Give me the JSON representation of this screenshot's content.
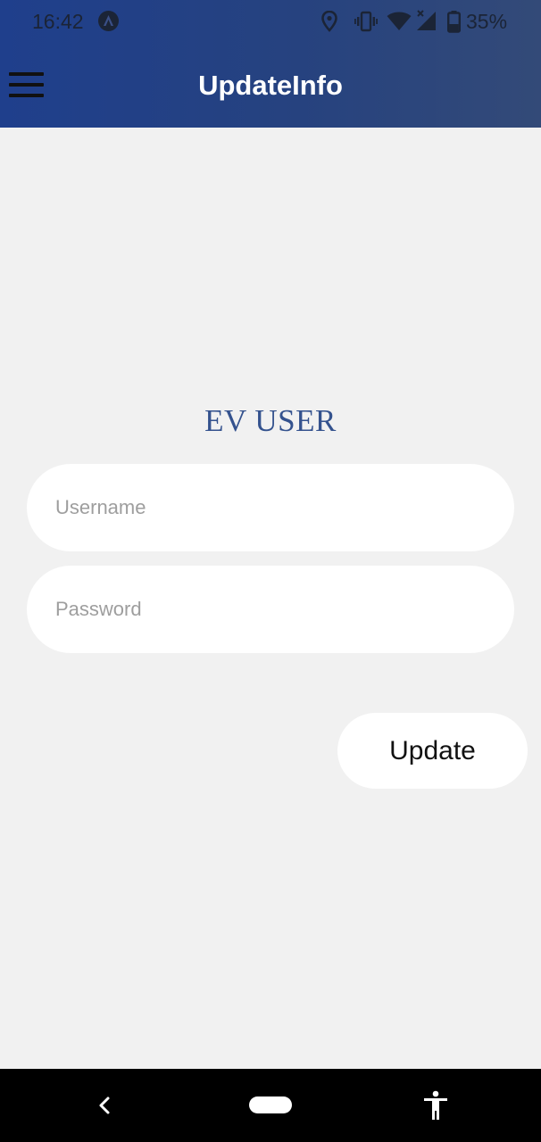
{
  "status_bar": {
    "time": "16:42",
    "battery": "35%",
    "icons": [
      "app-notification-icon",
      "location-icon",
      "vibrate-icon",
      "wifi-icon",
      "signal-icon",
      "battery-icon"
    ]
  },
  "app_bar": {
    "menu_icon": "hamburger-menu-icon",
    "title": "UpdateInfo",
    "gradient": [
      "#1f3f8c",
      "#334a78"
    ]
  },
  "form": {
    "heading": "EV USER",
    "username": {
      "value": "",
      "placeholder": "Username"
    },
    "password": {
      "value": "",
      "placeholder": "Password"
    },
    "submit_label": "Update"
  },
  "nav_bar": {
    "icons": [
      "back-icon",
      "home-pill-icon",
      "accessibility-icon"
    ]
  },
  "colors": {
    "accent": "#34528e",
    "background": "#f1f1f1"
  }
}
